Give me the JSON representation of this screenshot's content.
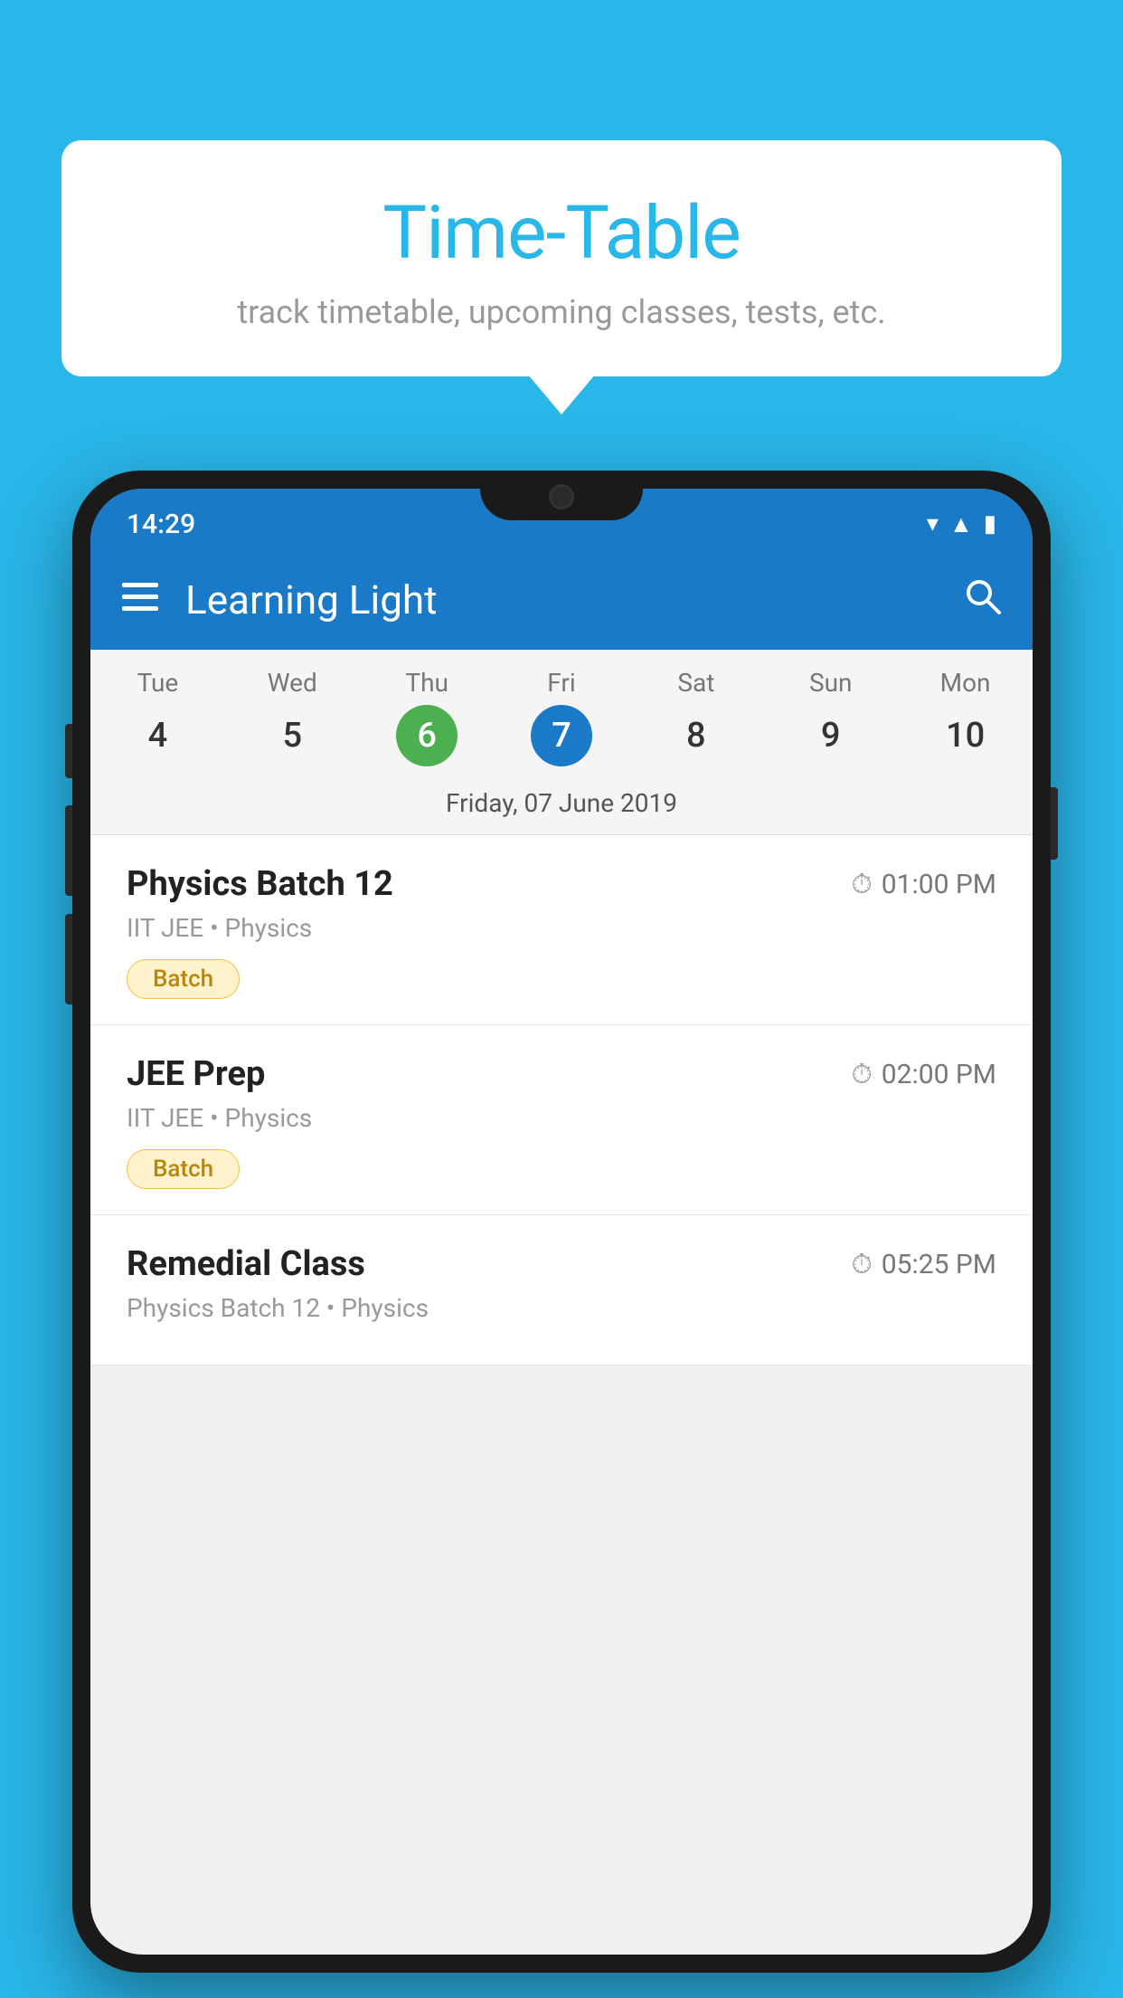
{
  "background_color": "#29b6e8",
  "bubble": {
    "title": "Time-Table",
    "subtitle": "track timetable, upcoming classes, tests, etc."
  },
  "phone": {
    "status_bar": {
      "time": "14:29"
    },
    "app_bar": {
      "title": "Learning Light"
    },
    "calendar": {
      "days": [
        {
          "name": "Tue",
          "number": "4",
          "state": "normal"
        },
        {
          "name": "Wed",
          "number": "5",
          "state": "normal"
        },
        {
          "name": "Thu",
          "number": "6",
          "state": "today"
        },
        {
          "name": "Fri",
          "number": "7",
          "state": "selected"
        },
        {
          "name": "Sat",
          "number": "8",
          "state": "normal"
        },
        {
          "name": "Sun",
          "number": "9",
          "state": "normal"
        },
        {
          "name": "Mon",
          "number": "10",
          "state": "normal"
        }
      ],
      "selected_date_label": "Friday, 07 June 2019"
    },
    "schedule": [
      {
        "title": "Physics Batch 12",
        "time": "01:00 PM",
        "subtitle": "IIT JEE • Physics",
        "badge": "Batch"
      },
      {
        "title": "JEE Prep",
        "time": "02:00 PM",
        "subtitle": "IIT JEE • Physics",
        "badge": "Batch"
      },
      {
        "title": "Remedial Class",
        "time": "05:25 PM",
        "subtitle": "Physics Batch 12 • Physics",
        "badge": null
      }
    ]
  }
}
